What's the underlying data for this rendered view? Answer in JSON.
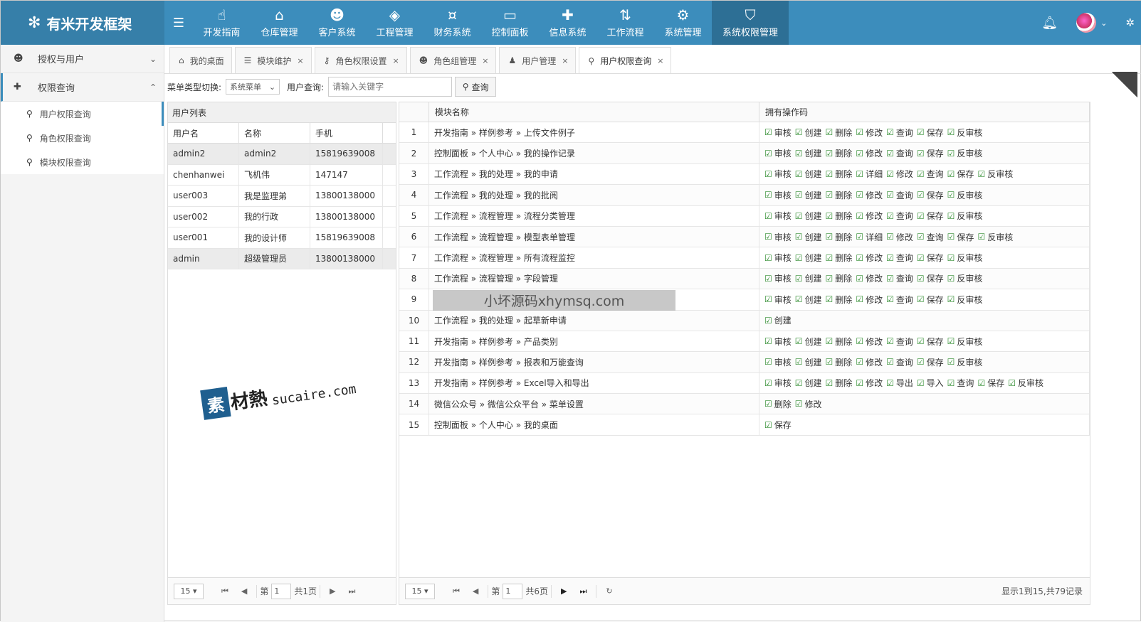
{
  "app": {
    "title": "有米开发框架"
  },
  "nav": [
    {
      "label": "开发指南",
      "icon": "hand-pointer-icon",
      "glyph": "☝"
    },
    {
      "label": "仓库管理",
      "icon": "bank-icon",
      "glyph": "⌂"
    },
    {
      "label": "客户系统",
      "icon": "users-icon",
      "glyph": "☻"
    },
    {
      "label": "工程管理",
      "icon": "cube-icon",
      "glyph": "◈"
    },
    {
      "label": "财务系统",
      "icon": "money-icon",
      "glyph": "¤"
    },
    {
      "label": "控制面板",
      "icon": "monitor-icon",
      "glyph": "▭"
    },
    {
      "label": "信息系统",
      "icon": "puzzle-icon",
      "glyph": "✚"
    },
    {
      "label": "工作流程",
      "icon": "sort-icon",
      "glyph": "⇅"
    },
    {
      "label": "系统管理",
      "icon": "gears-icon",
      "glyph": "⚙"
    },
    {
      "label": "系统权限管理",
      "icon": "shield-icon",
      "glyph": "⛉"
    }
  ],
  "sidebar": {
    "groups": [
      {
        "label": "授权与用户",
        "icon": "users-icon"
      },
      {
        "label": "权限查询",
        "icon": "puzzle-icon"
      }
    ],
    "items": [
      {
        "label": "用户权限查询"
      },
      {
        "label": "角色权限查询"
      },
      {
        "label": "模块权限查询"
      }
    ]
  },
  "tabs": [
    {
      "label": "我的桌面",
      "icon": "home-icon",
      "glyph": "⌂"
    },
    {
      "label": "模块维护",
      "icon": "list-icon",
      "glyph": "☰"
    },
    {
      "label": "角色权限设置",
      "icon": "key-icon",
      "glyph": "⚷"
    },
    {
      "label": "角色组管理",
      "icon": "users-icon",
      "glyph": "☻"
    },
    {
      "label": "用户管理",
      "icon": "user-icon",
      "glyph": "♟"
    },
    {
      "label": "用户权限查询",
      "icon": "search-icon",
      "glyph": "⚲"
    }
  ],
  "filter": {
    "menu_type_label": "菜单类型切换:",
    "menu_type_value": "系统菜单",
    "user_query_label": "用户查询:",
    "keyword_placeholder": "请输入关键字",
    "query_button": "查询"
  },
  "user_list": {
    "title": "用户列表",
    "columns": [
      "用户名",
      "名称",
      "手机"
    ],
    "rows": [
      {
        "username": "admin2",
        "name": "admin2",
        "phone": "15819639008"
      },
      {
        "username": "chenhanwei",
        "name": "飞机伟",
        "phone": "147147"
      },
      {
        "username": "user003",
        "name": "我是监理弟",
        "phone": "13800138000"
      },
      {
        "username": "user002",
        "name": "我的行政",
        "phone": "13800138000"
      },
      {
        "username": "user001",
        "name": "我的设计师",
        "phone": "15819639008"
      },
      {
        "username": "admin",
        "name": "超级管理员",
        "phone": "13800138000"
      }
    ],
    "pager": {
      "page_size": "15",
      "page_prefix": "第",
      "page": "1",
      "total_pages": "共1页"
    }
  },
  "permissions": {
    "columns": [
      "",
      "模块名称",
      "拥有操作码"
    ],
    "rows": [
      {
        "idx": "1",
        "module": "开发指南 » 样例参考 » 上传文件例子",
        "codes": [
          "审核",
          "创建",
          "删除",
          "修改",
          "查询",
          "保存",
          "反审核"
        ]
      },
      {
        "idx": "2",
        "module": "控制面板 » 个人中心 » 我的操作记录",
        "codes": [
          "审核",
          "创建",
          "删除",
          "修改",
          "查询",
          "保存",
          "反审核"
        ]
      },
      {
        "idx": "3",
        "module": "工作流程 » 我的处理 » 我的申请",
        "codes": [
          "审核",
          "创建",
          "删除",
          "详细",
          "修改",
          "查询",
          "保存",
          "反审核"
        ]
      },
      {
        "idx": "4",
        "module": "工作流程 » 我的处理 » 我的批阅",
        "codes": [
          "审核",
          "创建",
          "删除",
          "修改",
          "查询",
          "保存",
          "反审核"
        ]
      },
      {
        "idx": "5",
        "module": "工作流程 » 流程管理 » 流程分类管理",
        "codes": [
          "审核",
          "创建",
          "删除",
          "修改",
          "查询",
          "保存",
          "反审核"
        ]
      },
      {
        "idx": "6",
        "module": "工作流程 » 流程管理 » 模型表单管理",
        "codes": [
          "审核",
          "创建",
          "删除",
          "详细",
          "修改",
          "查询",
          "保存",
          "反审核"
        ]
      },
      {
        "idx": "7",
        "module": "工作流程 » 流程管理 » 所有流程监控",
        "codes": [
          "审核",
          "创建",
          "删除",
          "修改",
          "查询",
          "保存",
          "反审核"
        ]
      },
      {
        "idx": "8",
        "module": "工作流程 » 流程管理 » 字段管理",
        "codes": [
          "审核",
          "创建",
          "删除",
          "修改",
          "查询",
          "保存",
          "反审核"
        ]
      },
      {
        "idx": "9",
        "module": "",
        "codes": [
          "审核",
          "创建",
          "删除",
          "修改",
          "查询",
          "保存",
          "反审核"
        ]
      },
      {
        "idx": "10",
        "module": "工作流程 » 我的处理 » 起草新申请",
        "codes": [
          "创建"
        ]
      },
      {
        "idx": "11",
        "module": "开发指南 » 样例参考 » 产品类别",
        "codes": [
          "审核",
          "创建",
          "删除",
          "修改",
          "查询",
          "保存",
          "反审核"
        ]
      },
      {
        "idx": "12",
        "module": "开发指南 » 样例参考 » 报表和万能查询",
        "codes": [
          "审核",
          "创建",
          "删除",
          "修改",
          "查询",
          "保存",
          "反审核"
        ]
      },
      {
        "idx": "13",
        "module": "开发指南 » 样例参考 » Excel导入和导出",
        "codes": [
          "审核",
          "创建",
          "删除",
          "修改",
          "导出",
          "导入",
          "查询",
          "保存",
          "反审核"
        ]
      },
      {
        "idx": "14",
        "module": "微信公众号 » 微信公众平台 » 菜单设置",
        "codes": [
          "删除",
          "修改"
        ]
      },
      {
        "idx": "15",
        "module": "控制面板 » 个人中心 » 我的桌面",
        "codes": [
          "保存"
        ]
      }
    ],
    "pager": {
      "page_size": "15",
      "page_prefix": "第",
      "page": "1",
      "total_pages": "共6页",
      "summary": "显示1到15,共79记录"
    }
  },
  "watermarks": {
    "banner": "小坏源码xhymsq.com",
    "logo_char": "素",
    "logo_text": "材熱",
    "logo_domain": "sucaire.com"
  },
  "colors": {
    "brand": "#3c8dbc",
    "check": "#2e8b2e"
  }
}
